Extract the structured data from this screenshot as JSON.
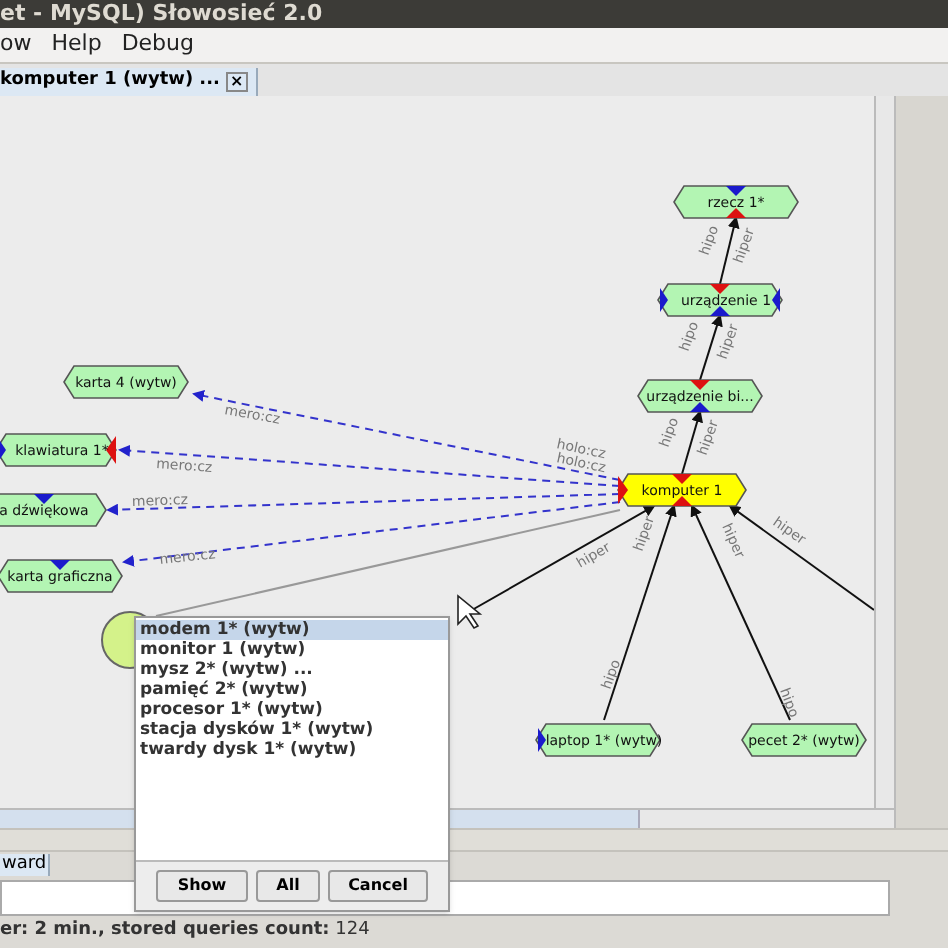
{
  "window": {
    "title": "et - MySQL) Słowosieć 2.0"
  },
  "menu": [
    {
      "label": "ow"
    },
    {
      "label": "Help"
    },
    {
      "label": "Debug"
    }
  ],
  "tabs": [
    {
      "label": "komputer 1 (wytw) ...",
      "selected": true,
      "close": "×"
    }
  ],
  "graph": {
    "nodes": [
      {
        "kind": "hex",
        "label": "rzecz 1*",
        "selected": false
      },
      {
        "kind": "hex",
        "label": "urządzenie 1",
        "selected": false
      },
      {
        "kind": "hex",
        "label": "urządzenie bi...",
        "selected": false
      },
      {
        "kind": "hex",
        "label": "komputer 1",
        "selected": true
      },
      {
        "kind": "hex",
        "label": "karta 4 (wytw)",
        "selected": false
      },
      {
        "kind": "hex",
        "label": "klawiatura 1*",
        "selected": false
      },
      {
        "kind": "hex",
        "label": "a dźwiękowa",
        "selected": false
      },
      {
        "kind": "hex",
        "label": "karta graficzna",
        "selected": false
      },
      {
        "kind": "hex",
        "label": "laptop 1* (wytw)",
        "selected": false
      },
      {
        "kind": "hex",
        "label": "pecet 2* (wytw)",
        "selected": false
      },
      {
        "kind": "round",
        "selected": false
      }
    ],
    "edges": [
      {
        "kind": "dashed",
        "labels": [
          "mero:cz"
        ]
      },
      {
        "kind": "dashed",
        "labels": [
          "mero:cz"
        ]
      },
      {
        "kind": "dashed",
        "labels": [
          "mero:cz"
        ]
      },
      {
        "kind": "dashed",
        "labels": [
          "mero:cz"
        ]
      },
      {
        "kind": "solid"
      },
      {
        "kind": "arrow",
        "labels": [
          "hipo",
          "hiper"
        ]
      },
      {
        "kind": "arrow",
        "labels": [
          "hipo",
          "hiper"
        ]
      },
      {
        "kind": "arrow",
        "labels": [
          "hipo",
          "hiper"
        ]
      },
      {
        "kind": "arrow",
        "labels": [
          "hiper"
        ]
      },
      {
        "kind": "arrow",
        "labels": [
          "hiper",
          "hipo"
        ]
      },
      {
        "kind": "arrow",
        "labels": [
          "hiper",
          "hipo"
        ]
      },
      {
        "kind": "arrow",
        "labels": [
          "hiper"
        ]
      }
    ],
    "near_labels": [
      "holo:cz",
      "holo:cz"
    ]
  },
  "popup": {
    "items": [
      {
        "label": "modem 1* (wytw)",
        "selected": true
      },
      {
        "label": "monitor 1 (wytw)",
        "selected": false
      },
      {
        "label": "mysz 2* (wytw) ...",
        "selected": false
      },
      {
        "label": "pamięć 2* (wytw)",
        "selected": false
      },
      {
        "label": "procesor 1* (wytw)",
        "selected": false
      },
      {
        "label": "stacja dysków 1* (wytw)",
        "selected": false
      },
      {
        "label": "twardy dysk 1* (wytw)",
        "selected": false
      }
    ],
    "buttons": [
      "Show",
      "All",
      "Cancel"
    ]
  },
  "bottom_tab": {
    "label": "ward"
  },
  "status_bar": "**er: 2 min., stored queries count:** 124"
}
